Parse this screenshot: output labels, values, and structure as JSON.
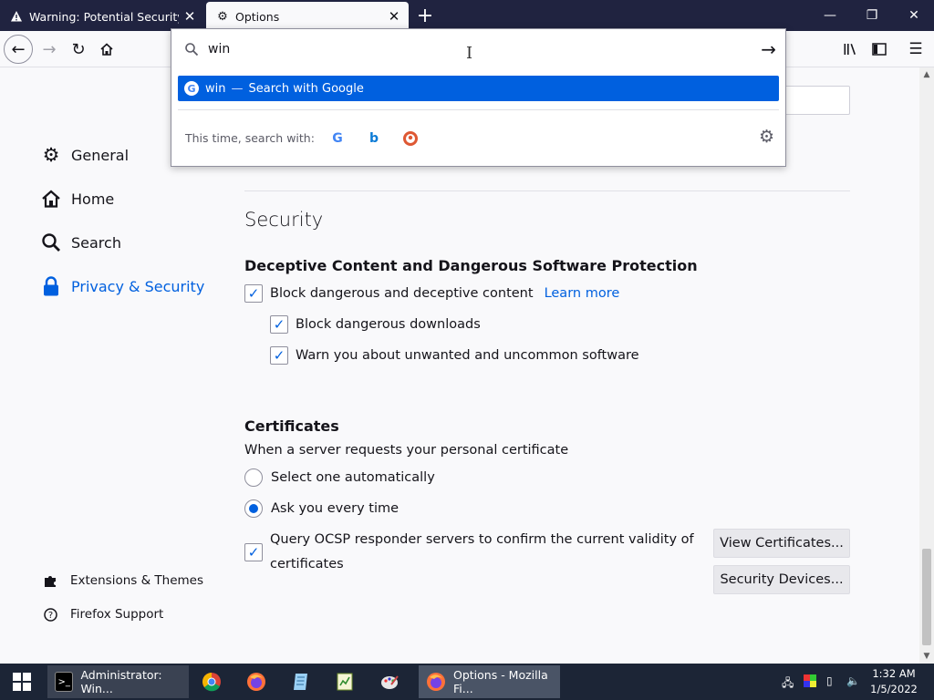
{
  "tabs": [
    {
      "title": "Warning: Potential Security Risk Ahead",
      "active": false
    },
    {
      "title": "Options",
      "active": true
    }
  ],
  "urlbar": {
    "value": "win",
    "suggestion": {
      "term": "win",
      "separator": "—",
      "action": "Search with Google"
    },
    "this_time_label": "This time, search with:",
    "engines": [
      "Google",
      "Bing",
      "DuckDuckGo"
    ]
  },
  "sidebar": {
    "categories": [
      {
        "label": "General",
        "icon": "gear-icon"
      },
      {
        "label": "Home",
        "icon": "home-icon"
      },
      {
        "label": "Search",
        "icon": "search-icon"
      },
      {
        "label": "Privacy & Security",
        "icon": "lock-icon",
        "selected": true
      }
    ],
    "links": [
      {
        "label": "Extensions & Themes",
        "icon": "puzzle-icon"
      },
      {
        "label": "Firefox Support",
        "icon": "help-icon"
      }
    ]
  },
  "security": {
    "heading": "Security",
    "deceptive_heading": "Deceptive Content and Dangerous Software Protection",
    "block_dangerous": "Block dangerous and deceptive content",
    "learn_more": "Learn more",
    "block_downloads": "Block dangerous downloads",
    "warn_unwanted": "Warn you about unwanted and uncommon software"
  },
  "certificates": {
    "heading": "Certificates",
    "intro": "When a server requests your personal certificate",
    "select_auto": "Select one automatically",
    "ask_every": "Ask you every time",
    "ocsp_line1": "Query OCSP responder servers to confirm the current validity of",
    "ocsp_line2": "certificates",
    "view_button": "View Certificates...",
    "devices_button": "Security Devices..."
  },
  "taskbar": {
    "cmd_label": "Administrator: Win...",
    "firefox_label": "Options - Mozilla Fi...",
    "time": "1:32 AM",
    "date": "1/5/2022"
  },
  "colors": {
    "accent": "#0060df",
    "tabbar": "#202340",
    "taskbar": "#1c2536"
  }
}
